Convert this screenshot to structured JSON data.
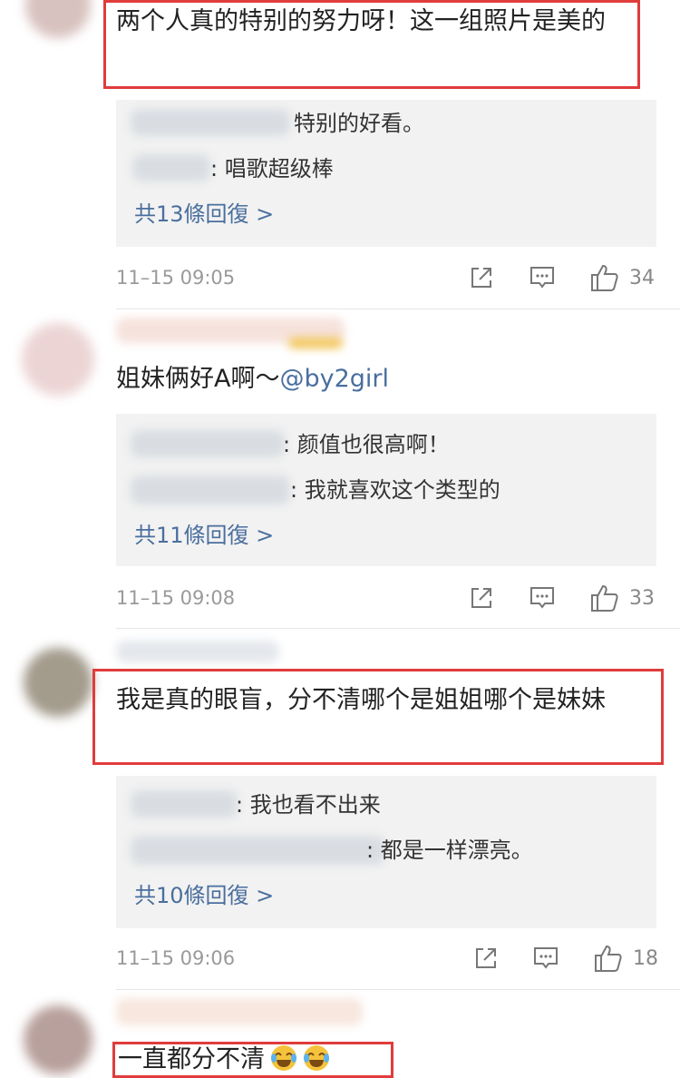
{
  "colors": {
    "highlight": "#e03c3c",
    "link": "#4a6f9e",
    "reply_bg": "#f2f2f2",
    "meta": "#9a9a9a"
  },
  "comments": [
    {
      "text": "两个人真的特别的努力呀！这一组照片是美的",
      "replies": [
        "特别的好看。",
        ": 唱歌超级棒"
      ],
      "more": "共13條回復 >",
      "time": "11–15 09:05",
      "likes": "34"
    },
    {
      "text_before": "姐妹俩好A啊～",
      "mention": "@by2girl",
      "replies": [
        ": 颜值也很高啊！",
        ": 我就喜欢这个类型的"
      ],
      "more": "共11條回復 >",
      "time": "11–15 09:08",
      "likes": "33"
    },
    {
      "text": "我是真的眼盲，分不清哪个是姐姐哪个是妹妹",
      "replies": [
        ": 我也看不出来",
        ": 都是一样漂亮。"
      ],
      "more": "共10條回復 >",
      "time": "11–15 09:06",
      "likes": "18"
    },
    {
      "text": "一直都分不清",
      "emojis": [
        "laugh-cry-emoji",
        "laugh-cry-emoji"
      ]
    }
  ],
  "icons": [
    "share-icon",
    "comment-icon",
    "like-icon"
  ]
}
